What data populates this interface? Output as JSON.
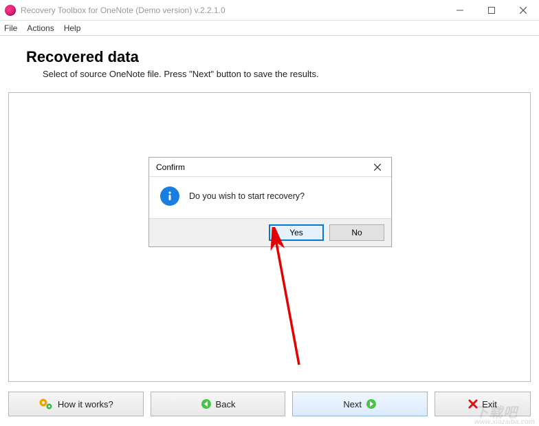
{
  "titlebar": {
    "title": "Recovery Toolbox for OneNote (Demo version) v.2.2.1.0"
  },
  "menu": {
    "file": "File",
    "actions": "Actions",
    "help": "Help"
  },
  "header": {
    "title": "Recovered data",
    "subtitle": "Select of source OneNote file. Press \"Next\" button to save the results."
  },
  "dialog": {
    "title": "Confirm",
    "message": "Do you wish to start recovery?",
    "yes": "Yes",
    "no": "No"
  },
  "footer": {
    "how": "How it works?",
    "back": "Back",
    "next": "Next",
    "exit": "Exit"
  },
  "watermark": {
    "big": "下载吧",
    "small": "www.xiazaiba.com"
  }
}
